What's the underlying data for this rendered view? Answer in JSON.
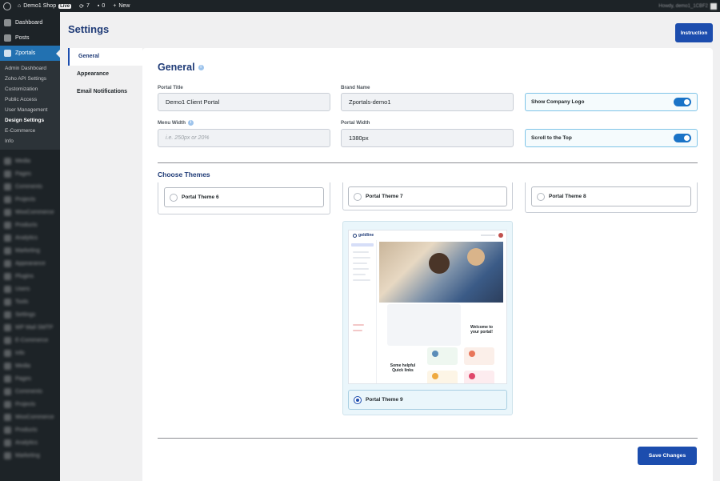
{
  "adminbar": {
    "site_name": "Demo1 Shop",
    "live_badge": "Live",
    "updates_count": "7",
    "comments_count": "0",
    "new_label": "New",
    "howdy": "Howdy, demo1_1CBF2"
  },
  "sidebar": {
    "dashboard": "Dashboard",
    "posts": "Posts",
    "zportals": "Zportals",
    "submenu": [
      {
        "label": "Admin Dashboard"
      },
      {
        "label": "Zoho API Settings"
      },
      {
        "label": "Customization"
      },
      {
        "label": "Public Access"
      },
      {
        "label": "User Management"
      },
      {
        "label": "Design Settings"
      },
      {
        "label": "E-Commerce"
      },
      {
        "label": "Info"
      }
    ],
    "blurred_items": [
      "Media",
      "Pages",
      "Comments",
      "Projects",
      "WooCommerce",
      "Products",
      "Analytics",
      "Marketing",
      "Appearance",
      "Plugins",
      "Users",
      "Tools",
      "Settings",
      "WP Mail SMTP",
      "E-Commerce",
      "Info",
      "Media",
      "Pages",
      "Comments",
      "Projects",
      "WooCommerce",
      "Products",
      "Analytics",
      "Marketing"
    ]
  },
  "page": {
    "title": "Settings",
    "instruction_button": "Instruction"
  },
  "tabs": [
    {
      "label": "General"
    },
    {
      "label": "Appearance"
    },
    {
      "label": "Email Notifications"
    }
  ],
  "general": {
    "section_title": "General",
    "portal_title_label": "Portal Title",
    "portal_title_value": "Demo1 Client Portal",
    "brand_name_label": "Brand Name",
    "brand_name_value": "Zportals-demo1",
    "show_logo_label": "Show Company Logo",
    "menu_width_label": "Menu Width",
    "menu_width_placeholder": "i.e. 250px or 20%",
    "portal_width_label": "Portal Width",
    "portal_width_value": "1380px",
    "scroll_top_label": "Scroll to the Top"
  },
  "themes": {
    "title": "Choose Themes",
    "options": [
      {
        "label": "Portal Theme 6"
      },
      {
        "label": "Portal Theme 7"
      },
      {
        "label": "Portal Theme 8"
      },
      {
        "label": "Portal Theme 9"
      }
    ],
    "preview": {
      "logo": "goldline",
      "welcome": "Welcome to your portal!",
      "quick_links": "Some helpful Quick links"
    }
  },
  "save_button": "Save Changes",
  "colors": {
    "accent": "#1c4dae",
    "title": "#1f3b77",
    "admin_bar": "#1d2327",
    "menu_current": "#2271b1"
  }
}
